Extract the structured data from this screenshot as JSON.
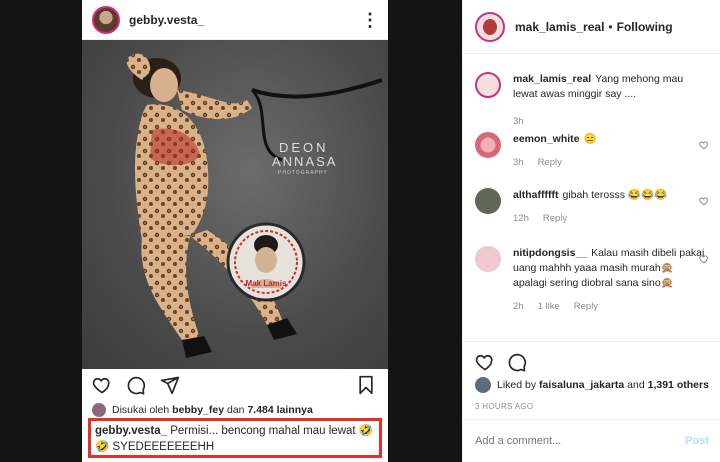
{
  "post": {
    "username": "gebby.vesta_",
    "photo": {
      "watermark_line1": "DEON",
      "watermark_line2": "ANNASA",
      "watermark_line3": "PHOTOGRAPHY",
      "badge_text": "Mak Lamis"
    },
    "liked_prefix": "Disukai oleh",
    "liked_user": "bebby_fey",
    "liked_mid": "dan",
    "liked_count": "7.484 lainnya",
    "caption_user": "gebby.vesta_",
    "caption_text": "Permisi... bencong mahal mau lewat 🤣",
    "caption_text2": "🤣 SYEDEEEEEEEHH"
  },
  "panel": {
    "username": "mak_lamis_real",
    "following": "Following",
    "comments": [
      {
        "user": "mak_lamis_real",
        "text": "Yang mehong mau lewat awas minggir say ....",
        "time": "3h",
        "reply": "",
        "likes": ""
      },
      {
        "user": "eemon_white",
        "text": "😑",
        "time": "3h",
        "reply": "Reply",
        "likes": ""
      },
      {
        "user": "althaffffft",
        "text": "gibah terosss 😂😂😂",
        "time": "12h",
        "reply": "Reply",
        "likes": ""
      },
      {
        "user": "nitipdongsis__",
        "text": "Kalau masih dibeli pakai uang mahhh yaaa masih murah🙊 apalagi sering diobral sana sino🙊",
        "time": "2h",
        "reply": "Reply",
        "likes": "1 like"
      }
    ],
    "liked_prefix": "Liked by",
    "liked_user": "faisaluna_jakarta",
    "liked_mid": "and",
    "liked_count": "1,391 others",
    "timestamp": "3 HOURS AGO",
    "add_comment_placeholder": "Add a comment...",
    "post_label": "Post"
  },
  "colors": {
    "highlight_border": "#e0312b",
    "post_button": "#b2dffc",
    "story_ring": "#c13584"
  }
}
